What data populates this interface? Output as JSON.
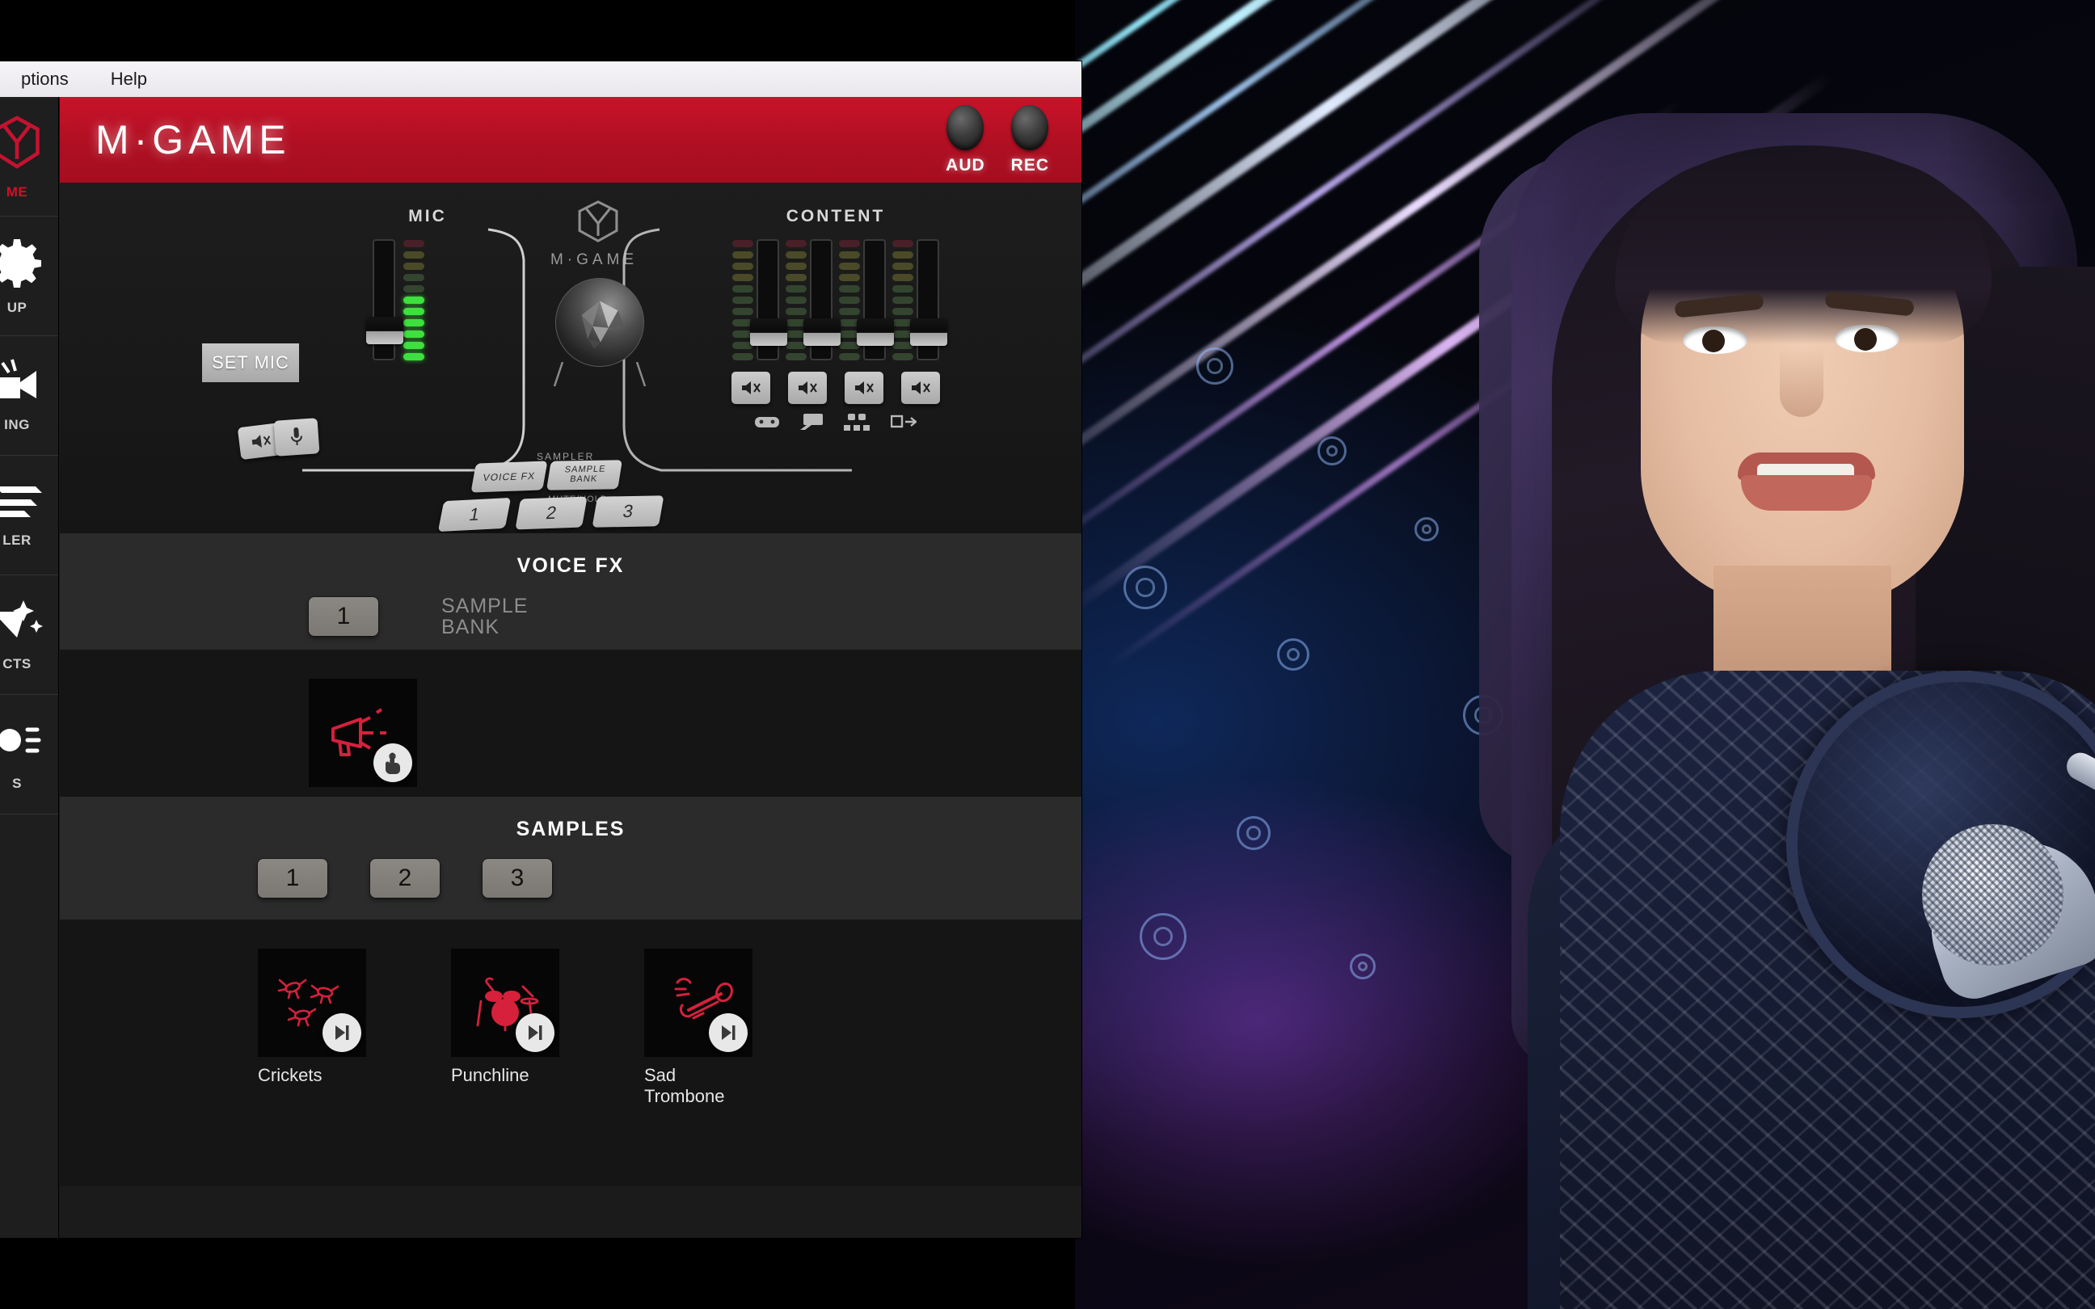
{
  "window": {
    "menubar": [
      {
        "label": "ptions",
        "name": "menu-options"
      },
      {
        "label": "Help",
        "name": "menu-help"
      }
    ]
  },
  "sidebar": {
    "items": [
      {
        "label": "ME",
        "icon": "mgame-logo-icon",
        "name": "sidebar-item-home",
        "active": true
      },
      {
        "label": "UP",
        "icon": "gear-icon",
        "name": "sidebar-item-setup",
        "active": false
      },
      {
        "label": "ING",
        "icon": "broadcast-icon",
        "name": "sidebar-item-streaming",
        "active": false
      },
      {
        "label": "LER",
        "icon": "sampler-pad-icon",
        "name": "sidebar-item-sampler",
        "active": false
      },
      {
        "label": "CTS",
        "icon": "effects-icon",
        "name": "sidebar-item-effects",
        "active": false
      },
      {
        "label": "S",
        "icon": "lighting-icon",
        "name": "sidebar-item-lights",
        "active": false
      }
    ]
  },
  "header": {
    "brand": "M·GAME",
    "leds": [
      {
        "label": "AUD",
        "name": "aud-indicator"
      },
      {
        "label": "REC",
        "name": "rec-indicator"
      }
    ]
  },
  "device": {
    "logo_name": "M·GAME",
    "mic_label": "MIC",
    "content_label": "CONTENT",
    "sampler_label": "SAMPLER",
    "set_mic_button": "SET MIC",
    "voice_fx_button": "VOICE FX",
    "sample_bank_button": "SAMPLE BANK",
    "mute_hold_label": "MUTE/HOLD",
    "pads": [
      "1",
      "2",
      "3"
    ],
    "mic_meter_on": 6,
    "mic_meter_total": 10,
    "content_channels": [
      {
        "icon": "game-controller-icon",
        "name": "content-channel-game"
      },
      {
        "icon": "chat-bubble-icon",
        "name": "content-channel-chat"
      },
      {
        "icon": "music-icon",
        "name": "content-channel-music"
      },
      {
        "icon": "aux-in-icon",
        "name": "content-channel-aux"
      }
    ]
  },
  "voice_fx": {
    "title": "VOICE FX",
    "selector": {
      "label": "1",
      "name": "voicefx-slot-1"
    },
    "sample_bank_label_line1": "SAMPLE",
    "sample_bank_label_line2": "BANK",
    "tiles": [
      {
        "label": "Megaphone",
        "icon": "megaphone-icon",
        "badge": "hold-touch-icon",
        "name": "voicefx-tile-megaphone"
      }
    ]
  },
  "samples": {
    "title": "SAMPLES",
    "selectors": [
      {
        "label": "1",
        "name": "sample-slot-1"
      },
      {
        "label": "2",
        "name": "sample-slot-2"
      },
      {
        "label": "3",
        "name": "sample-slot-3"
      }
    ],
    "tiles": [
      {
        "label": "Crickets",
        "icon": "crickets-icon",
        "badge": "play-to-end-icon",
        "name": "sample-tile-crickets"
      },
      {
        "label": "Punchline",
        "icon": "drumkit-icon",
        "badge": "play-to-end-icon",
        "name": "sample-tile-punchline"
      },
      {
        "label": "Sad Trombone",
        "icon": "trombone-icon",
        "badge": "play-to-end-icon",
        "name": "sample-tile-sad-trombone"
      }
    ]
  },
  "colors": {
    "brand_red": "#b00f22",
    "accent_red": "#d6203c",
    "panel_dark": "#151515",
    "panel_mid": "#2b2b2b",
    "led_green": "#3ee03e"
  }
}
